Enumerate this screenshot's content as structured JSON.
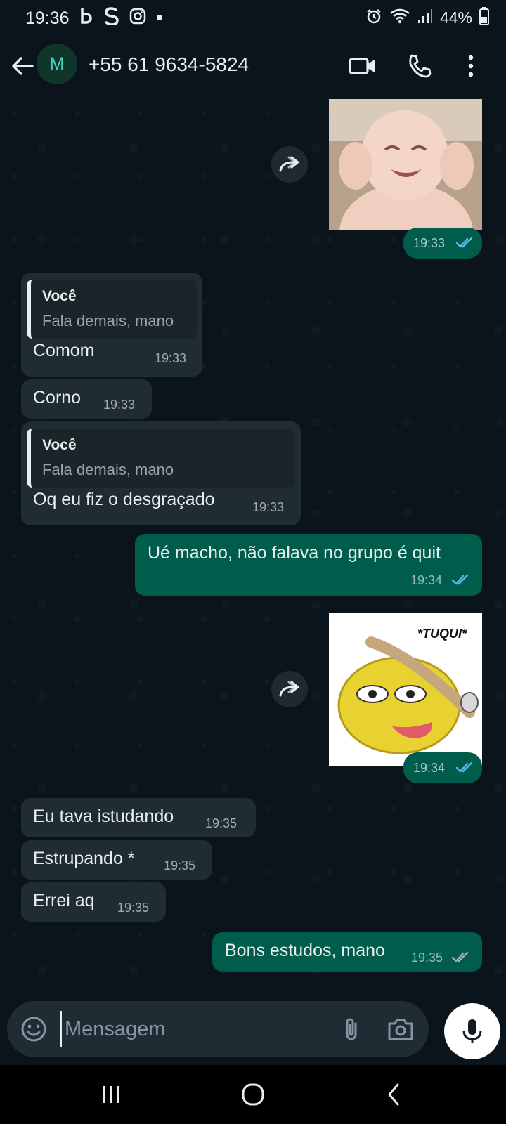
{
  "status_bar": {
    "time": "19:36",
    "battery": "44%",
    "left_icons": [
      "b-app-icon",
      "s-app-icon",
      "instagram-icon",
      "dot-icon"
    ],
    "right_icons": [
      "alarm-icon",
      "wifi-icon",
      "signal-icon",
      "battery-icon"
    ]
  },
  "header": {
    "avatar_letter": "M",
    "contact": "+55 61 9634-5824",
    "icons": [
      "back-arrow-icon",
      "video-call-icon",
      "phone-icon",
      "more-vert-icon"
    ]
  },
  "messages": [
    {
      "id": "m1",
      "type": "image",
      "direction": "out",
      "description_icon": "baby-photo",
      "time": "19:33",
      "status": "read"
    },
    {
      "id": "m2",
      "type": "reply",
      "direction": "in",
      "quote_author": "Você",
      "quote_text": "Fala demais, mano",
      "text": "Comom",
      "time": "19:33"
    },
    {
      "id": "m3",
      "type": "text",
      "direction": "in",
      "text": "Corno",
      "time": "19:33"
    },
    {
      "id": "m4",
      "type": "reply",
      "direction": "in",
      "quote_author": "Você",
      "quote_text": "Fala demais, mano",
      "text": "Oq eu fiz o desgraçado",
      "time": "19:33"
    },
    {
      "id": "m5",
      "type": "text",
      "direction": "out",
      "text": "Ué macho, não falava no grupo é quit",
      "time": "19:34",
      "status": "read"
    },
    {
      "id": "m6",
      "type": "image",
      "direction": "out",
      "caption_in_image": "*TUQUI*",
      "time": "19:34",
      "status": "read"
    },
    {
      "id": "m7",
      "type": "text",
      "direction": "in",
      "text": "Eu tava istudando",
      "time": "19:35"
    },
    {
      "id": "m8",
      "type": "text",
      "direction": "in",
      "text": "Estrupando *",
      "time": "19:35"
    },
    {
      "id": "m9",
      "type": "text",
      "direction": "in",
      "text": "Errei aq",
      "time": "19:35"
    },
    {
      "id": "m10",
      "type": "text",
      "direction": "out",
      "text": "Bons estudos, mano",
      "time": "19:35",
      "status": "delivered"
    }
  ],
  "composer": {
    "placeholder": "Mensagem",
    "icons": [
      "emoji-icon",
      "attach-icon",
      "camera-icon",
      "mic-icon"
    ]
  },
  "nav_bar": {
    "icons": [
      "recents-icon",
      "home-icon",
      "back-icon"
    ]
  },
  "colors": {
    "background": "#0b141a",
    "incoming_bubble": "#202c33",
    "outgoing_bubble": "#005c4b",
    "read_tick": "#53bdeb",
    "text": "#e9edef"
  }
}
